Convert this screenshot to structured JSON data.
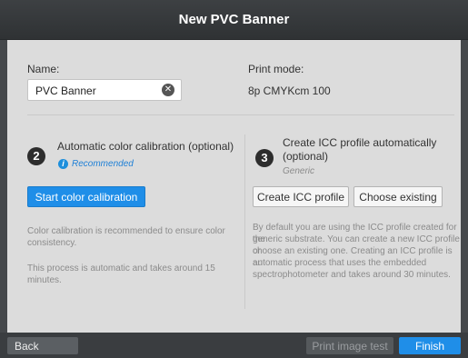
{
  "window": {
    "title": "New PVC Banner"
  },
  "name_field": {
    "label": "Name:",
    "value": "PVC Banner"
  },
  "print_mode": {
    "label": "Print mode:",
    "value": "8p CMYKcm 100"
  },
  "step2": {
    "number": "2",
    "title": "Automatic color calibration (optional)",
    "info_glyph": "i",
    "recommended": "Recommended",
    "button": "Start color calibration",
    "desc1_line1": "Color calibration is recommended to ensure color",
    "desc1_line2": "consistency.",
    "desc2_line1": "This process is automatic and takes around 15",
    "desc2_line2": "minutes."
  },
  "step3": {
    "number": "3",
    "title_line1": "Create ICC profile automatically",
    "title_line2": "(optional)",
    "generic": "Generic",
    "button_create": "Create ICC profile",
    "button_choose": "Choose existing",
    "desc_line1": "By default you are using the ICC profile created for the",
    "desc_line2": "generic substrate. You can create a new ICC profile or",
    "desc_line3": "choose an existing one. Creating an ICC profile is an",
    "desc_line4": "automatic process that uses the embedded",
    "desc_line5": "spectrophotometer and takes around 30 minutes."
  },
  "footer": {
    "back": "Back",
    "print_test": "Print image test",
    "finish": "Finish"
  },
  "icons": {
    "clear": "clear-circle-x-icon",
    "info": "info-icon"
  },
  "colors": {
    "accent": "#1f8ee8",
    "panel": "#dcdcdc",
    "titlebar": "#333638"
  }
}
